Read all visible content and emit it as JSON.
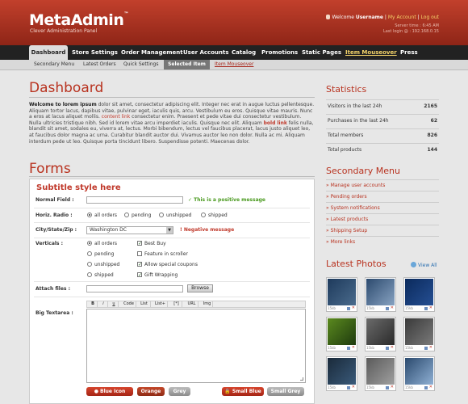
{
  "app": {
    "logo": "MetaAdmin",
    "logo_tm": "™",
    "tagline": "Clever Administration Panel",
    "welcome_prefix": "Welcome ",
    "username": "Username",
    "separator": " | ",
    "my_account": "My Account",
    "logout": "Log out",
    "server_time": "Server time : 6:45 AM",
    "last_login": "Last login @ : 192.168.0.15"
  },
  "main_nav": [
    "Dashboard",
    "Store Settings",
    "Order Management",
    "User Accounts",
    "Catalog",
    "Promotions",
    "Static Pages",
    "Item Mouseover",
    "Press"
  ],
  "sub_nav": [
    "Secondary Menu",
    "Latest Orders",
    "Quick Settings",
    "Selected Item",
    "Item Mouseover"
  ],
  "dashboard": {
    "title": "Dashboard",
    "intro_bold": "Welcome to lorem ipsum",
    "p1": " dolor sit amet, consectetur adipiscing elit. Integer nec erat in augue luctus pellentesque. Aliquam tortor lacus, dapibus vitae, pulvinar eget, iaculis quis, arcu. Vestibulum eu eros. Quisque vitae mauris. Nunc a eros at lacus aliquet mollis. ",
    "link": "content link",
    "p2": " consectetur enim. Praesent et pede vitae dui consectetur vestibulum. Nulla ultricies tristique nibh. Sed id lorem vitae arcu imperdiet iaculis. Quisque nec elit. Aliquam ",
    "bold_link": "bold link",
    "p3": " felis nulla, blandit sit amet, sodales eu, viverra at, lectus. Morbi bibendum, lectus vel faucibus placerat, lacus justo aliquet leo, at faucibus dolor magna ac urna. Curabitur blandit auctor dui. Vivamus auctor leo non dolor. Nulla ac mi. Aliquam interdum pede ut leo. Quisque porta tincidunt libero. Suspendisse potenti. Maecenas dolor."
  },
  "forms": {
    "title": "Forms",
    "subtitle": "Subtitle style here",
    "normal_field_label": "Normal Field :",
    "positive_msg": "This is a positive message",
    "horiz_radio_label": "Horiz. Radio :",
    "horiz_radio_options": [
      "all orders",
      "pending",
      "unshipped",
      "shipped"
    ],
    "city_label": "City/State/Zip :",
    "city_value": "Washington DC",
    "negative_msg": "Negative message",
    "verticals_label": "Verticals :",
    "vertical_radios": [
      "all orders",
      "pending",
      "unshipped",
      "shipped"
    ],
    "vertical_checks": [
      "Best Buy",
      "Feature in scroller",
      "Allow special coupons",
      "Gift Wrapping"
    ],
    "vertical_checks_state": [
      true,
      false,
      true,
      true
    ],
    "attach_label": "Attach files :",
    "browse": "Browse",
    "textarea_label": "Big Textarea :",
    "toolbar": [
      "B",
      "i",
      "u",
      "Code",
      "List",
      "List+",
      "[*]",
      "URL",
      "Img"
    ],
    "buttons": [
      "Blue Icon",
      "Orange",
      "Grey",
      "Small Blue",
      "Small Grey"
    ]
  },
  "statistics": {
    "title": "Statistics",
    "rows": [
      {
        "label": "Visitors in the last 24h",
        "value": "2165"
      },
      {
        "label": "Purchases in the last 24h",
        "value": "62"
      },
      {
        "label": "Total members",
        "value": "826"
      },
      {
        "label": "Total products",
        "value": "144"
      }
    ]
  },
  "secondary_menu": {
    "title": "Secondary Menu",
    "items": [
      "» Manage user accounts",
      "» Pending orders",
      "» System notifications",
      "» Latest products",
      "» Shipping Setup",
      "» More links"
    ]
  },
  "photos": {
    "title": "Latest Photos",
    "view_all": "View All",
    "meta": "15kb"
  },
  "colors": {
    "brand_red": "#b8321f",
    "header_top": "#c2402c",
    "nav_bg": "#222222"
  }
}
